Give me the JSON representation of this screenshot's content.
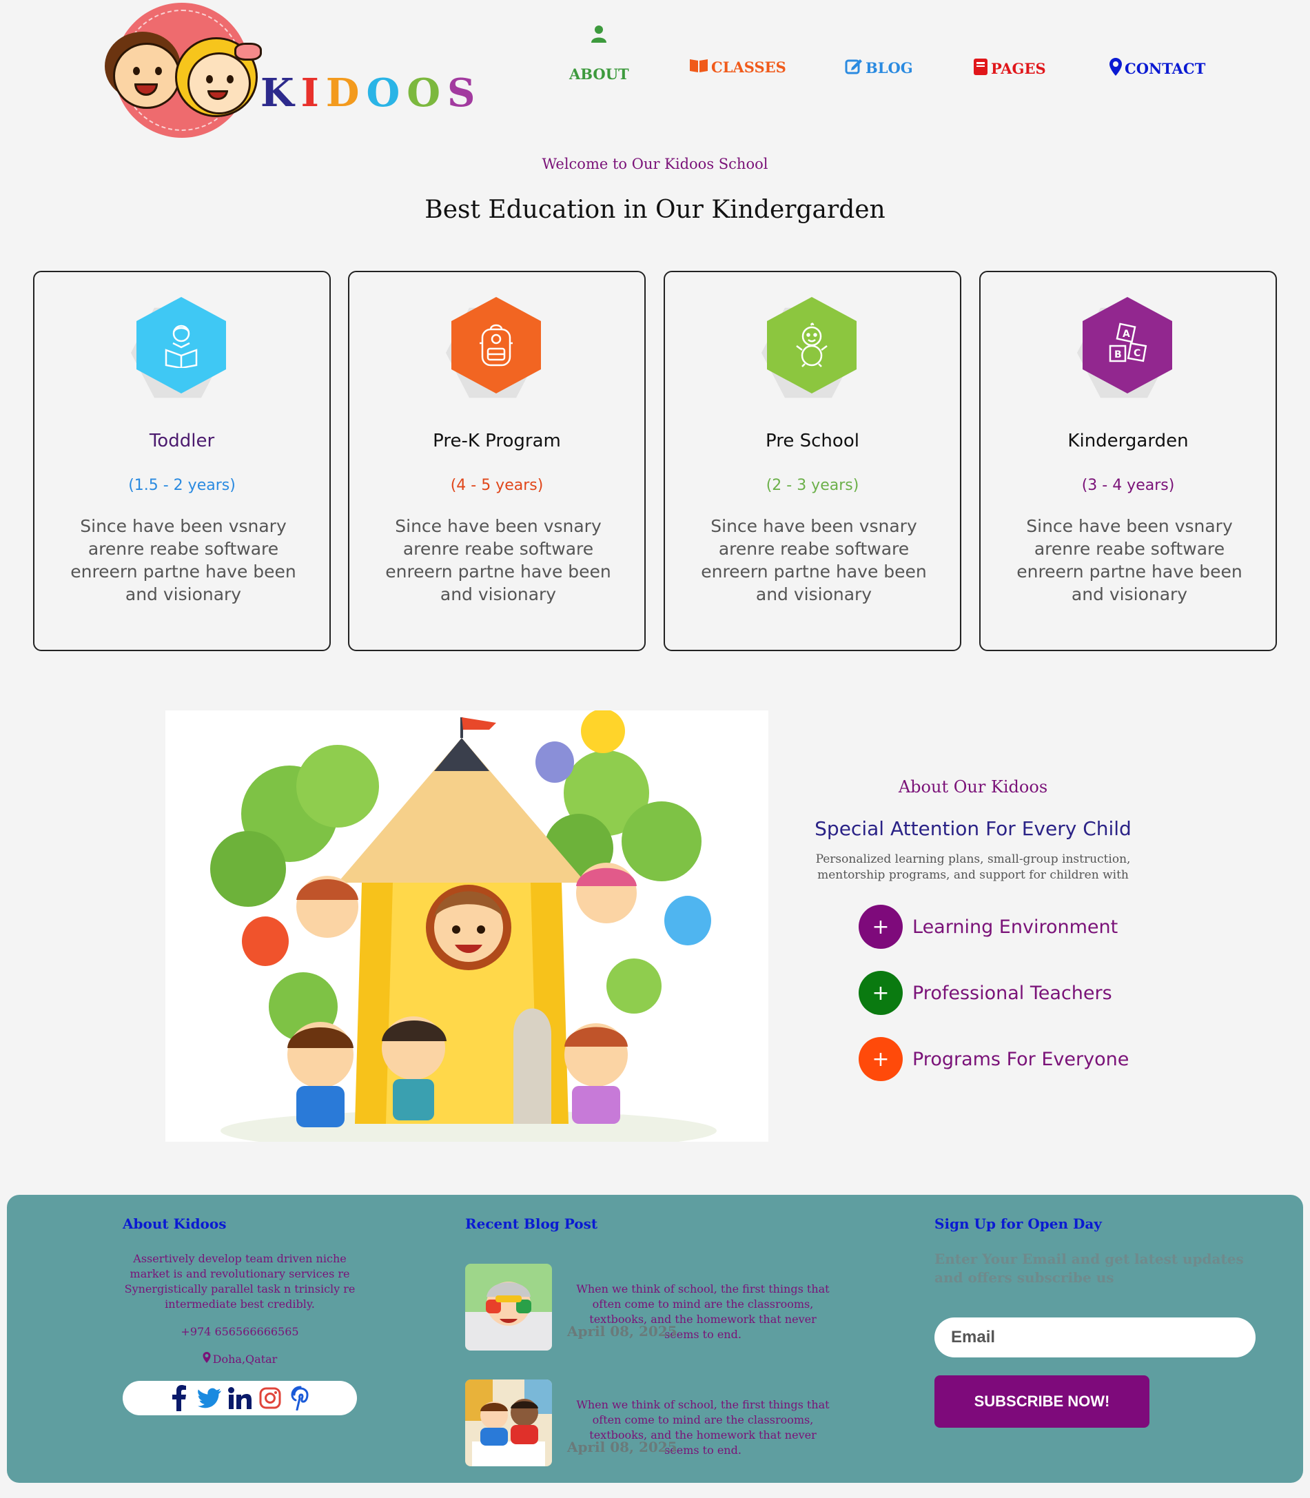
{
  "brand": {
    "logo_text": [
      "K",
      "I",
      "D",
      "O",
      "O",
      "S"
    ]
  },
  "nav": {
    "about": "ABOUT",
    "classes": "CLASSES",
    "blog": "BLOG",
    "pages": "PAGES",
    "contact": "CONTACT"
  },
  "hero": {
    "welcome": "Welcome to Our Kidoos School",
    "headline": "Best Education in Our Kindergarden"
  },
  "programs": [
    {
      "title": "Toddler",
      "age": "(1.5 - 2 years)",
      "desc": "Since have been vsnary arenre reabe software enreern partne have been and visionary",
      "color": "#3fc8f4",
      "title_color": "#4b1a6e",
      "age_color": "#2a8ae0",
      "icon": "child-reading-icon"
    },
    {
      "title": "Pre-K Program",
      "age": "(4 - 5 years)",
      "desc": "Since have been vsnary arenre reabe software enreern partne have been and visionary",
      "color": "#f26522",
      "title_color": "#111111",
      "age_color": "#e0461a",
      "icon": "backpack-icon"
    },
    {
      "title": "Pre School",
      "age": "(2 - 3 years)",
      "desc": "Since have been vsnary arenre reabe software enreern partne have been and visionary",
      "color": "#8cc63f",
      "title_color": "#111111",
      "age_color": "#6cb04a",
      "icon": "baby-icon"
    },
    {
      "title": "Kindergarden",
      "age": "(3 - 4 years)",
      "desc": "Since have been vsnary arenre reabe software enreern partne have been and visionary",
      "color": "#92278f",
      "title_color": "#111111",
      "age_color": "#7a1278",
      "icon": "abc-blocks-icon"
    }
  ],
  "about": {
    "label": "About Our Kidoos",
    "title": "Special Attention For Every Child",
    "desc": "Personalized learning plans, small-group instruction, mentorship programs, and support for children with",
    "features": [
      {
        "text": "Learning Environment",
        "color": "#7e0a7b"
      },
      {
        "text": "Professional Teachers",
        "color": "#0a7a10"
      },
      {
        "text": "Programs For Everyone",
        "color": "#ff4a0a"
      }
    ]
  },
  "footer": {
    "about_heading": "About Kidoos",
    "about_text": "Assertively develop team driven niche market is and revolutionary services re Synergistically parallel task n trinsicly re intermediate best credibly.",
    "phone": "+974 656566666565",
    "location": "Doha,Qatar",
    "social": [
      "facebook-icon",
      "twitter-icon",
      "linkedin-icon",
      "instagram-icon",
      "pinterest-icon"
    ],
    "blog_heading": "Recent Blog Post",
    "posts": [
      {
        "text": "When we think of school, the first things that often come to mind are the classrooms, textbooks, and the homework that never seems to end.",
        "date": "April 08, 2025"
      },
      {
        "text": "When we think of school, the first things that often come to mind are the classrooms, textbooks, and the homework that never seems to end.",
        "date": "April 08, 2025"
      }
    ],
    "signup_heading": "Sign Up for Open Day",
    "signup_desc": "Enter Your Email and get latest updates and offers subscribe us",
    "email_placeholder": "Email",
    "subscribe_label": "SUBSCRIBE NOW!"
  }
}
